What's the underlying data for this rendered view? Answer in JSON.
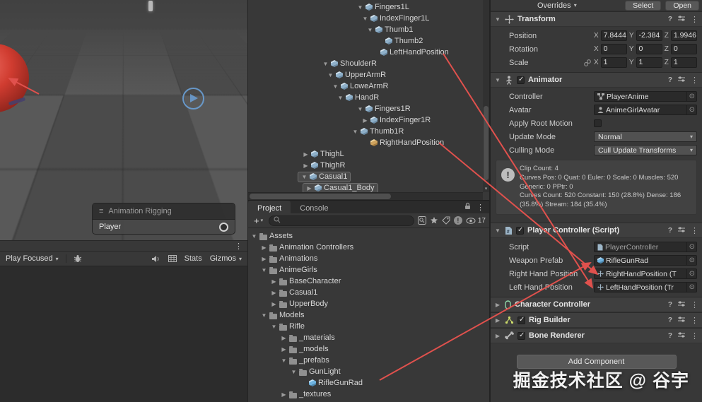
{
  "icons": {
    "menu": "⋮",
    "picker": "⊙",
    "caret_down": "▾",
    "help": "?",
    "plus": "+",
    "handle": "≡",
    "alert": "!",
    "fold_open": "▼",
    "fold_closed": "▶"
  },
  "colors": {
    "annotation_red": "#e0514d",
    "prefab_blue": "#6fb3e0",
    "panel_bg": "#383838"
  },
  "scene": {
    "rigging_overlay": {
      "title": "Animation Rigging",
      "value": "Player"
    },
    "game_toolbar": {
      "play_mode": "Play Focused",
      "stats": "Stats",
      "gizmos": "Gizmos"
    }
  },
  "hierarchy": {
    "items": [
      {
        "label": "Fingers1L",
        "arrow": "▼",
        "icon": "cube",
        "depth": 22
      },
      {
        "label": "IndexFinger1L",
        "arrow": "▼",
        "icon": "cube",
        "depth": 23
      },
      {
        "label": "Thumb1",
        "arrow": "▼",
        "icon": "cube",
        "depth": 24
      },
      {
        "label": "Thumb2",
        "arrow": "",
        "icon": "cube",
        "depth": 26
      },
      {
        "label": "LeftHandPosition",
        "arrow": "",
        "icon": "cube",
        "depth": 25
      },
      {
        "label": "ShoulderR",
        "arrow": "▼",
        "icon": "cube",
        "depth": 15
      },
      {
        "label": "UpperArmR",
        "arrow": "▼",
        "icon": "cube",
        "depth": 16
      },
      {
        "label": "LoweArmR",
        "arrow": "▼",
        "icon": "cube",
        "depth": 17
      },
      {
        "label": "HandR",
        "arrow": "▼",
        "icon": "cube",
        "depth": 18
      },
      {
        "label": "Fingers1R",
        "arrow": "▼",
        "icon": "cube",
        "depth": 22
      },
      {
        "label": "IndexFinger1R",
        "arrow": "▶",
        "icon": "cube",
        "depth": 23
      },
      {
        "label": "Thumb1R",
        "arrow": "▼",
        "icon": "cube",
        "depth": 21
      },
      {
        "label": "RightHandPosition",
        "arrow": "",
        "icon": "cube-orange",
        "depth": 23
      },
      {
        "label": "ThighL",
        "arrow": "▶",
        "icon": "cube",
        "depth": 11
      },
      {
        "label": "ThighR",
        "arrow": "▶",
        "icon": "cube",
        "depth": 11
      },
      {
        "label": "Casual1",
        "arrow": "▼",
        "icon": "cube",
        "depth": 10,
        "selected": true
      },
      {
        "label": "Casual1_Body",
        "arrow": "▶",
        "icon": "cube",
        "depth": 11,
        "selected": true
      }
    ]
  },
  "project": {
    "tabs": {
      "project": "Project",
      "console": "Console"
    },
    "search_value": "",
    "hidden_count": "17",
    "tree": [
      {
        "label": "Assets",
        "arrow": "▼",
        "icon": "folder",
        "depth": 0
      },
      {
        "label": "Animation Controllers",
        "arrow": "▶",
        "icon": "folder",
        "depth": 1
      },
      {
        "label": "Animations",
        "arrow": "▶",
        "icon": "folder",
        "depth": 1
      },
      {
        "label": "AnimeGirls",
        "arrow": "▼",
        "icon": "folder",
        "depth": 1
      },
      {
        "label": "BaseCharacter",
        "arrow": "▶",
        "icon": "folder",
        "depth": 2
      },
      {
        "label": "Casual1",
        "arrow": "▶",
        "icon": "folder",
        "depth": 2
      },
      {
        "label": "UpperBody",
        "arrow": "▶",
        "icon": "folder",
        "depth": 2
      },
      {
        "label": "Models",
        "arrow": "▼",
        "icon": "folder",
        "depth": 1
      },
      {
        "label": "Rifle",
        "arrow": "▼",
        "icon": "folder",
        "depth": 2
      },
      {
        "label": "_materials",
        "arrow": "▶",
        "icon": "folder",
        "depth": 3
      },
      {
        "label": "_models",
        "arrow": "▶",
        "icon": "folder",
        "depth": 3
      },
      {
        "label": "_prefabs",
        "arrow": "▼",
        "icon": "folder",
        "depth": 3
      },
      {
        "label": "GunLight",
        "arrow": "▼",
        "icon": "folder",
        "depth": 4
      },
      {
        "label": "RifleGunRad",
        "arrow": "",
        "icon": "prefab",
        "depth": 5
      },
      {
        "label": "_textures",
        "arrow": "▶",
        "icon": "folder",
        "depth": 3
      }
    ]
  },
  "inspector": {
    "prefab_bar": {
      "overrides": "Overrides",
      "select": "Select",
      "open": "Open"
    },
    "transform": {
      "title": "Transform",
      "axis": [
        "X",
        "Y",
        "Z"
      ],
      "rows": [
        {
          "label": "Position",
          "x": "7.8444",
          "y": "-2.384",
          "z": "1.9946"
        },
        {
          "label": "Rotation",
          "x": "0",
          "y": "0",
          "z": "0"
        },
        {
          "label": "Scale",
          "x": "1",
          "y": "1",
          "z": "1"
        }
      ]
    },
    "animator": {
      "title": "Animator",
      "controller_label": "Controller",
      "controller": "PlayerAnime",
      "avatar_label": "Avatar",
      "avatar": "AnimeGirlAvatar",
      "root_motion_label": "Apply Root Motion",
      "update_mode_label": "Update Mode",
      "update_mode": "Normal",
      "culling_mode_label": "Culling Mode",
      "culling_mode": "Cull Update Transforms",
      "info": "Clip Count: 4\nCurves Pos: 0 Quat: 0 Euler: 0 Scale: 0 Muscles: 520 Generic: 0 PPtr: 0\nCurves Count: 520 Constant: 150 (28.8%) Dense: 186 (35.8%) Stream: 184 (35.4%)"
    },
    "player_controller": {
      "title": "Player Controller (Script)",
      "script_label": "Script",
      "script": "PlayerController",
      "weapon_label": "Weapon Prefab",
      "weapon": "RifleGunRad",
      "right_label": "Right Hand Position",
      "right": "RightHandPosition (T",
      "left_label": "Left Hand Position",
      "left": "LeftHandPosition (Tr"
    },
    "character_controller": {
      "title": "Character Controller"
    },
    "rig_builder": {
      "title": "Rig Builder"
    },
    "bone_renderer": {
      "title": "Bone Renderer"
    },
    "add_component": "Add Component"
  },
  "watermark": "掘金技术社区 @ 谷宇"
}
